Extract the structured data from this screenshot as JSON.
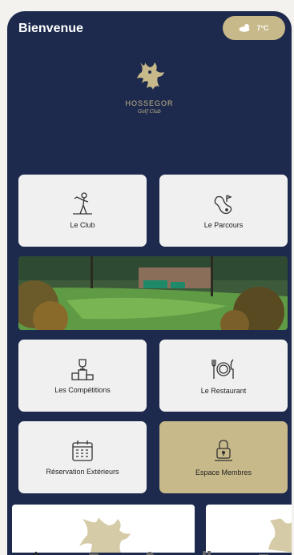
{
  "header": {
    "greeting": "Bienvenue",
    "weather": {
      "icon": "cloud-icon",
      "temperature": "7°C"
    }
  },
  "logo": {
    "name": "HOSSEGOR",
    "subtitle": "Golf Club"
  },
  "tiles": [
    {
      "label": "Le Club",
      "icon": "golfer-icon"
    },
    {
      "label": "Le Parcours",
      "icon": "course-map-icon"
    },
    {
      "label": "Les Compétitions",
      "icon": "trophy-podium-icon"
    },
    {
      "label": "Le Restaurant",
      "icon": "plate-cutlery-icon"
    },
    {
      "label": "Réservation Extérieurs",
      "icon": "calendar-icon"
    },
    {
      "label": "Espace Membres",
      "icon": "padlock-icon"
    }
  ],
  "colors": {
    "background": "#1d2a4d",
    "accent": "#c8b98a",
    "tile": "#f0f0f0"
  }
}
